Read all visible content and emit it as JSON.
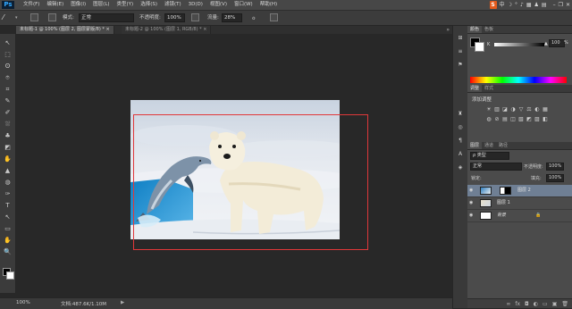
{
  "app": {
    "logo": "Ps"
  },
  "menu": [
    "文件(F)",
    "编辑(E)",
    "图像(I)",
    "图层(L)",
    "类型(Y)",
    "选择(S)",
    "滤镜(T)",
    "3D(D)",
    "视图(V)",
    "窗口(W)",
    "帮助(H)"
  ],
  "system_tray": {
    "ime": "S",
    "icons": [
      "中",
      "☽",
      "°",
      "♪",
      "▦",
      "♟",
      "▤"
    ]
  },
  "window_controls": {
    "minimize": "–",
    "restore": "❐",
    "close": "✕"
  },
  "options": {
    "mode_label": "模式:",
    "mode_value": "正常",
    "opacity_label": "不透明度:",
    "opacity_value": "100%",
    "flow_label": "流量:",
    "flow_value": "28%"
  },
  "tabs": [
    {
      "label": "未标题-1 @ 100% (图层 2, 图层蒙版/8) *",
      "close": "×",
      "active": true
    },
    {
      "label": "未标题-2 @ 100% (图层 1, RGB/8) *",
      "close": "×",
      "active": false
    }
  ],
  "tools": [
    "↖",
    "⬚",
    "ʘ",
    "⌾",
    "⌗",
    "✎",
    "✐",
    "⛆",
    "♣",
    "◩",
    "✋",
    "▲",
    "◍",
    "✑",
    "T",
    "↖",
    "▭",
    "✋",
    "🔍"
  ],
  "status": {
    "zoom": "100%",
    "doc": "文档:487.6K/1.10M",
    "arrow": "▶"
  },
  "color_panel": {
    "tabs": [
      "颜色",
      "色板"
    ],
    "k_label": "K",
    "k_value": "100",
    "k_unit": "%"
  },
  "adjust_panel": {
    "tabs": [
      "调整",
      "样式"
    ],
    "title": "添加调整"
  },
  "layers_panel": {
    "tabs": [
      "图层",
      "通道",
      "路径"
    ],
    "kind_label": "ρ 类型",
    "blend_mode": "正常",
    "opacity_label": "不透明度:",
    "opacity_value": "100%",
    "lock_label": "锁定:",
    "fill_label": "填充:",
    "fill_value": "100%",
    "layers": [
      {
        "name": "图层 2",
        "selected": true
      },
      {
        "name": "图层 1",
        "selected": false
      },
      {
        "name": "背景",
        "selected": false
      }
    ]
  }
}
